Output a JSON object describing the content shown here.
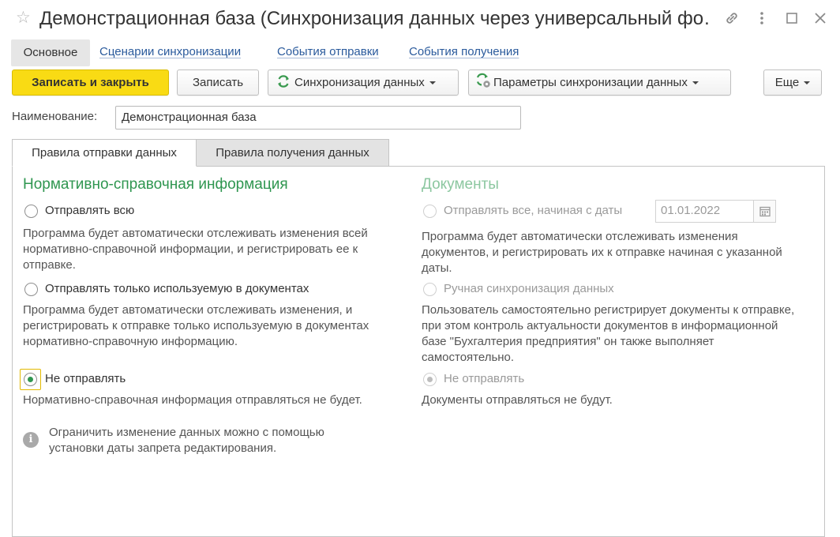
{
  "window": {
    "title": "Демонстрационная база (Синхронизация данных через универсальный фо…",
    "icons": [
      "star-icon",
      "link-icon",
      "more-vertical-icon",
      "maximize-icon",
      "close-icon"
    ]
  },
  "nav": {
    "main": "Основное",
    "links": [
      "Сценарии синхронизации",
      "События отправки",
      "События получения"
    ]
  },
  "toolbar": {
    "save_close": "Записать и закрыть",
    "save": "Записать",
    "sync": "Синхронизация данных",
    "sync_params": "Параметры синхронизации данных",
    "more": "Еще"
  },
  "name_field": {
    "label": "Наименование:",
    "value": "Демонстрационная база"
  },
  "form_tabs": {
    "send_rules": "Правила отправки данных",
    "receive_rules": "Правила получения данных"
  },
  "nsi": {
    "title": "Нормативно-справочная информация",
    "opt_all": "Отправлять всю",
    "opt_all_desc": "Программа будет автоматически отслеживать изменения всей нормативно-справочной информации, и регистрировать ее к отправке.",
    "opt_used": "Отправлять только используемую в документах",
    "opt_used_desc": "Программа будет автоматически отслеживать изменения, и регистрировать к отправке только используемую в документах нормативно-справочную информацию.",
    "opt_none": "Не отправлять",
    "opt_none_desc": "Нормативно-справочная информация отправляться не будет.",
    "selected": "Не отправлять"
  },
  "docs": {
    "title": "Документы",
    "opt_from_date": "Отправлять все, начиная с даты",
    "date_value": "01.01.2022",
    "opt_from_date_desc": "Программа будет автоматически отслеживать изменения документов, и регистрировать их к отправке начиная с указанной даты.",
    "opt_manual": "Ручная синхронизация данных",
    "opt_manual_desc": "Пользователь самостоятельно регистрирует документы к отправке, при этом контроль актуальности документов в информационной базе \"Бухгалтерия предприятия\" он также выполняет самостоятельно.",
    "opt_none": "Не отправлять",
    "opt_none_desc": "Документы отправляться не будут.",
    "selected": "Не отправлять"
  },
  "info": {
    "text": "Ограничить изменение данных можно с помощью установки даты запрета редактирования."
  },
  "colors": {
    "accent_green": "#2f9650",
    "primary_button": "#f9db14",
    "link_blue": "#2a5a9c"
  }
}
